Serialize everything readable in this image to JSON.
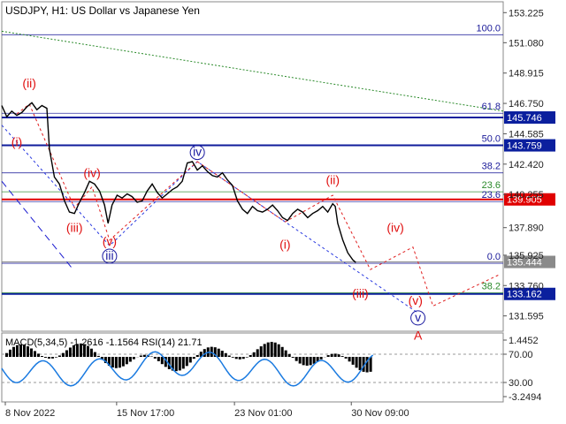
{
  "header": {
    "title": "USDJPY, H1:  US Dollar vs Japanese Yen"
  },
  "chart_data": [
    {
      "type": "line",
      "symbol": "USDJPY",
      "timeframe": "H1",
      "ylim": [
        130.5,
        154.0
      ],
      "y_ticks": [
        "153.225",
        "151.080",
        "148.915",
        "146.750",
        "144.585",
        "142.420",
        "140.255",
        "137.890",
        "135.925",
        "133.760",
        "131.595"
      ],
      "y_tick_values": [
        153.225,
        151.08,
        148.915,
        146.75,
        144.585,
        142.42,
        140.255,
        137.89,
        135.925,
        133.76,
        131.595
      ],
      "x_ticks": [
        "8 Nov 2022",
        "15 Nov 17:00",
        "23 Nov 01:00",
        "30 Nov 09:00"
      ],
      "price_levels": [
        {
          "label": "145.746",
          "value": 145.746,
          "color": "#0b1f9e"
        },
        {
          "label": "143.759",
          "value": 143.759,
          "color": "#0b1f9e"
        },
        {
          "label": "139.905",
          "value": 139.905,
          "color": "#e00000"
        },
        {
          "label": "135.444",
          "value": 135.444,
          "color": "#8a8a8a"
        },
        {
          "label": "133.162",
          "value": 133.162,
          "color": "#0b1f9e"
        }
      ],
      "fib_labels": [
        {
          "label": "100.0",
          "value": 151.9,
          "color": "#1a1a99"
        },
        {
          "label": "61.8",
          "value": 146.3,
          "color": "#1a1a99"
        },
        {
          "label": "50.0",
          "value": 144.0,
          "color": "#1a1a99"
        },
        {
          "label": "38.2",
          "value": 142.05,
          "color": "#1a1a99"
        },
        {
          "label": "23.6",
          "value": 140.7,
          "color": "#2a8a2a"
        },
        {
          "label": "23.6",
          "value": 140.0,
          "color": "#1a1a99"
        },
        {
          "label": "0.0",
          "value": 135.6,
          "color": "#1a1a99"
        },
        {
          "label": "38.2",
          "value": 133.5,
          "color": "#2a8a2a"
        }
      ],
      "wave_labels": [
        {
          "label": "(ii)",
          "color": "red",
          "t": 0.055,
          "v": 147.9
        },
        {
          "label": "(i)",
          "color": "red",
          "t": 0.03,
          "v": 143.7
        },
        {
          "label": "(iv)",
          "color": "red",
          "t": 0.18,
          "v": 141.5
        },
        {
          "label": "(iii)",
          "color": "red",
          "t": 0.145,
          "v": 137.6
        },
        {
          "label": "(v)",
          "color": "red",
          "t": 0.215,
          "v": 136.6
        },
        {
          "label": "iii",
          "color": "blue",
          "t": 0.215,
          "v": 135.6
        },
        {
          "label": "iv",
          "color": "blue",
          "t": 0.39,
          "v": 143.0
        },
        {
          "label": "(ii)",
          "color": "red",
          "t": 0.66,
          "v": 141.0
        },
        {
          "label": "(i)",
          "color": "red",
          "t": 0.565,
          "v": 136.4
        },
        {
          "label": "(iv)",
          "color": "red",
          "t": 0.785,
          "v": 137.6
        },
        {
          "label": "(iii)",
          "color": "red",
          "t": 0.715,
          "v": 132.9
        },
        {
          "label": "(v)",
          "color": "red",
          "t": 0.825,
          "v": 132.4
        },
        {
          "label": "v",
          "color": "blue",
          "t": 0.83,
          "v": 131.2
        },
        {
          "label": "A",
          "color": "red",
          "t": 0.83,
          "v": 129.9
        }
      ],
      "series": [
        {
          "values": [
            [
              0.0,
              146.6
            ],
            [
              0.01,
              145.8
            ],
            [
              0.02,
              146.2
            ],
            [
              0.03,
              145.9
            ],
            [
              0.04,
              146.1
            ],
            [
              0.05,
              146.5
            ],
            [
              0.06,
              146.8
            ],
            [
              0.07,
              146.3
            ],
            [
              0.08,
              146.6
            ],
            [
              0.09,
              146.4
            ],
            [
              0.095,
              143.5
            ],
            [
              0.105,
              141.5
            ],
            [
              0.115,
              141.0
            ],
            [
              0.125,
              139.8
            ],
            [
              0.135,
              139.0
            ],
            [
              0.145,
              138.9
            ],
            [
              0.155,
              139.7
            ],
            [
              0.165,
              140.4
            ],
            [
              0.175,
              141.2
            ],
            [
              0.185,
              141.0
            ],
            [
              0.195,
              140.5
            ],
            [
              0.205,
              139.5
            ],
            [
              0.212,
              138.2
            ],
            [
              0.22,
              139.5
            ],
            [
              0.23,
              140.2
            ],
            [
              0.24,
              140.0
            ],
            [
              0.25,
              140.3
            ],
            [
              0.26,
              140.1
            ],
            [
              0.27,
              139.7
            ],
            [
              0.28,
              139.8
            ],
            [
              0.29,
              140.5
            ],
            [
              0.3,
              141.0
            ],
            [
              0.31,
              140.4
            ],
            [
              0.32,
              140.0
            ],
            [
              0.33,
              140.3
            ],
            [
              0.34,
              140.6
            ],
            [
              0.35,
              140.8
            ],
            [
              0.36,
              141.2
            ],
            [
              0.37,
              142.5
            ],
            [
              0.38,
              142.6
            ],
            [
              0.39,
              142.0
            ],
            [
              0.4,
              142.3
            ],
            [
              0.41,
              141.9
            ],
            [
              0.42,
              141.6
            ],
            [
              0.43,
              141.5
            ],
            [
              0.44,
              141.8
            ],
            [
              0.45,
              141.3
            ],
            [
              0.46,
              140.9
            ],
            [
              0.47,
              139.8
            ],
            [
              0.48,
              139.2
            ],
            [
              0.49,
              138.9
            ],
            [
              0.5,
              139.4
            ],
            [
              0.51,
              139.1
            ],
            [
              0.52,
              139.0
            ],
            [
              0.53,
              139.2
            ],
            [
              0.54,
              139.5
            ],
            [
              0.55,
              139.1
            ],
            [
              0.56,
              138.6
            ],
            [
              0.57,
              138.4
            ],
            [
              0.58,
              138.9
            ],
            [
              0.59,
              139.2
            ],
            [
              0.6,
              139.0
            ],
            [
              0.61,
              138.6
            ],
            [
              0.62,
              138.9
            ],
            [
              0.63,
              139.1
            ],
            [
              0.64,
              139.4
            ],
            [
              0.65,
              139.0
            ],
            [
              0.66,
              139.6
            ],
            [
              0.665,
              139.4
            ],
            [
              0.67,
              138.2
            ],
            [
              0.68,
              137.0
            ],
            [
              0.69,
              136.1
            ],
            [
              0.7,
              135.6
            ],
            [
              0.706,
              135.4
            ]
          ]
        }
      ]
    },
    {
      "type": "line",
      "indicator": "MACD(5,34,5) -1.2616 -1.1564 RSI(14) 21.71",
      "ylim": [
        -3.2494,
        1.4452
      ],
      "y_ticks": [
        "1.4452",
        "70.00",
        "30.00",
        "-3.2494"
      ]
    }
  ]
}
